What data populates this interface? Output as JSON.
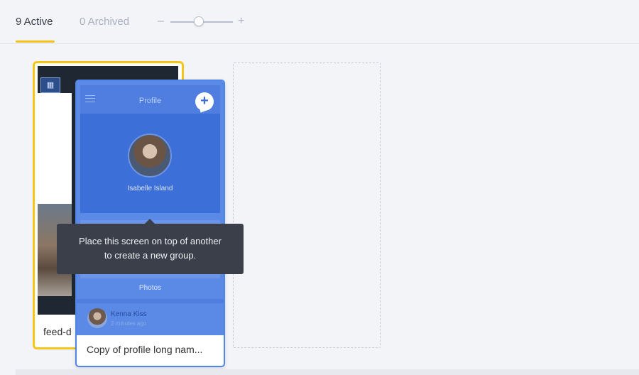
{
  "tabs": {
    "active_label": "9 Active",
    "archived_label": "0 Archived"
  },
  "zoom": {
    "minus": "–",
    "plus": "+",
    "level_fraction": 0.45
  },
  "cards": {
    "back": {
      "label": "feed-d"
    },
    "front": {
      "label": "Copy of profile long nam...",
      "screen": {
        "header_title": "Profile",
        "plus_icon": "+",
        "profile_name": "Isabelle Island",
        "photos_label": "Photos",
        "comment_name": "Kenna Kiss",
        "comment_time": "2 minutes ago"
      }
    }
  },
  "tooltip": {
    "line1": "Place this screen on top of another",
    "line2": "to create a new group."
  },
  "colors": {
    "accent_yellow": "#f5c518",
    "selection_blue": "#4f86e6",
    "tooltip_bg": "#3a3f4a"
  }
}
